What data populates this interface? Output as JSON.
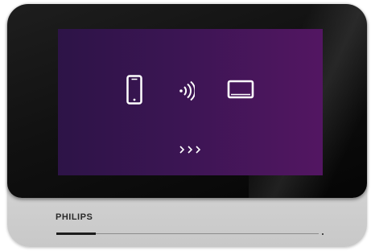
{
  "brand": {
    "name": "PHILIPS"
  },
  "screen": {
    "icons": [
      "smartphone-icon",
      "wireless-signal-icon",
      "monitor-icon"
    ],
    "next_indicator": "›››",
    "background_colors": [
      "#2d1447",
      "#531662"
    ]
  },
  "progress": {
    "value": 0.15
  }
}
